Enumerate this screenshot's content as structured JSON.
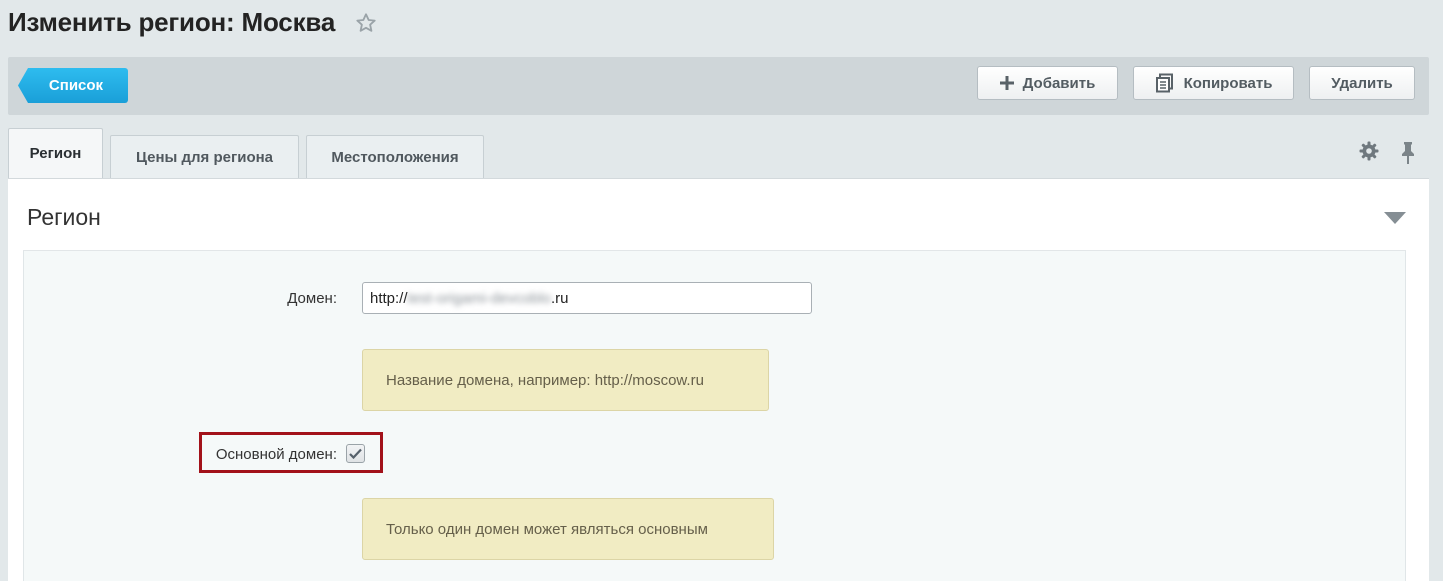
{
  "header": {
    "title": "Изменить регион: Москва"
  },
  "toolbar": {
    "list_label": "Список",
    "add_label": "Добавить",
    "copy_label": "Копировать",
    "delete_label": "Удалить"
  },
  "tabs": [
    {
      "label": "Регион",
      "active": true
    },
    {
      "label": "Цены для региона",
      "active": false
    },
    {
      "label": "Местоположения",
      "active": false
    }
  ],
  "section": {
    "title": "Регион",
    "domain": {
      "label": "Домен:",
      "value_prefix": "http://",
      "value_hidden": "test-origami-devcoblo",
      "value_suffix": ".ru",
      "hint": "Название домена, например: http://moscow.ru"
    },
    "main_domain": {
      "label": "Основной домен:",
      "checked": true,
      "hint": "Только один домен может являться основным"
    }
  },
  "colors": {
    "accent_blue": "#1fa8e0",
    "highlight_red": "#a2121a",
    "hint_background": "#f1ecc3"
  }
}
